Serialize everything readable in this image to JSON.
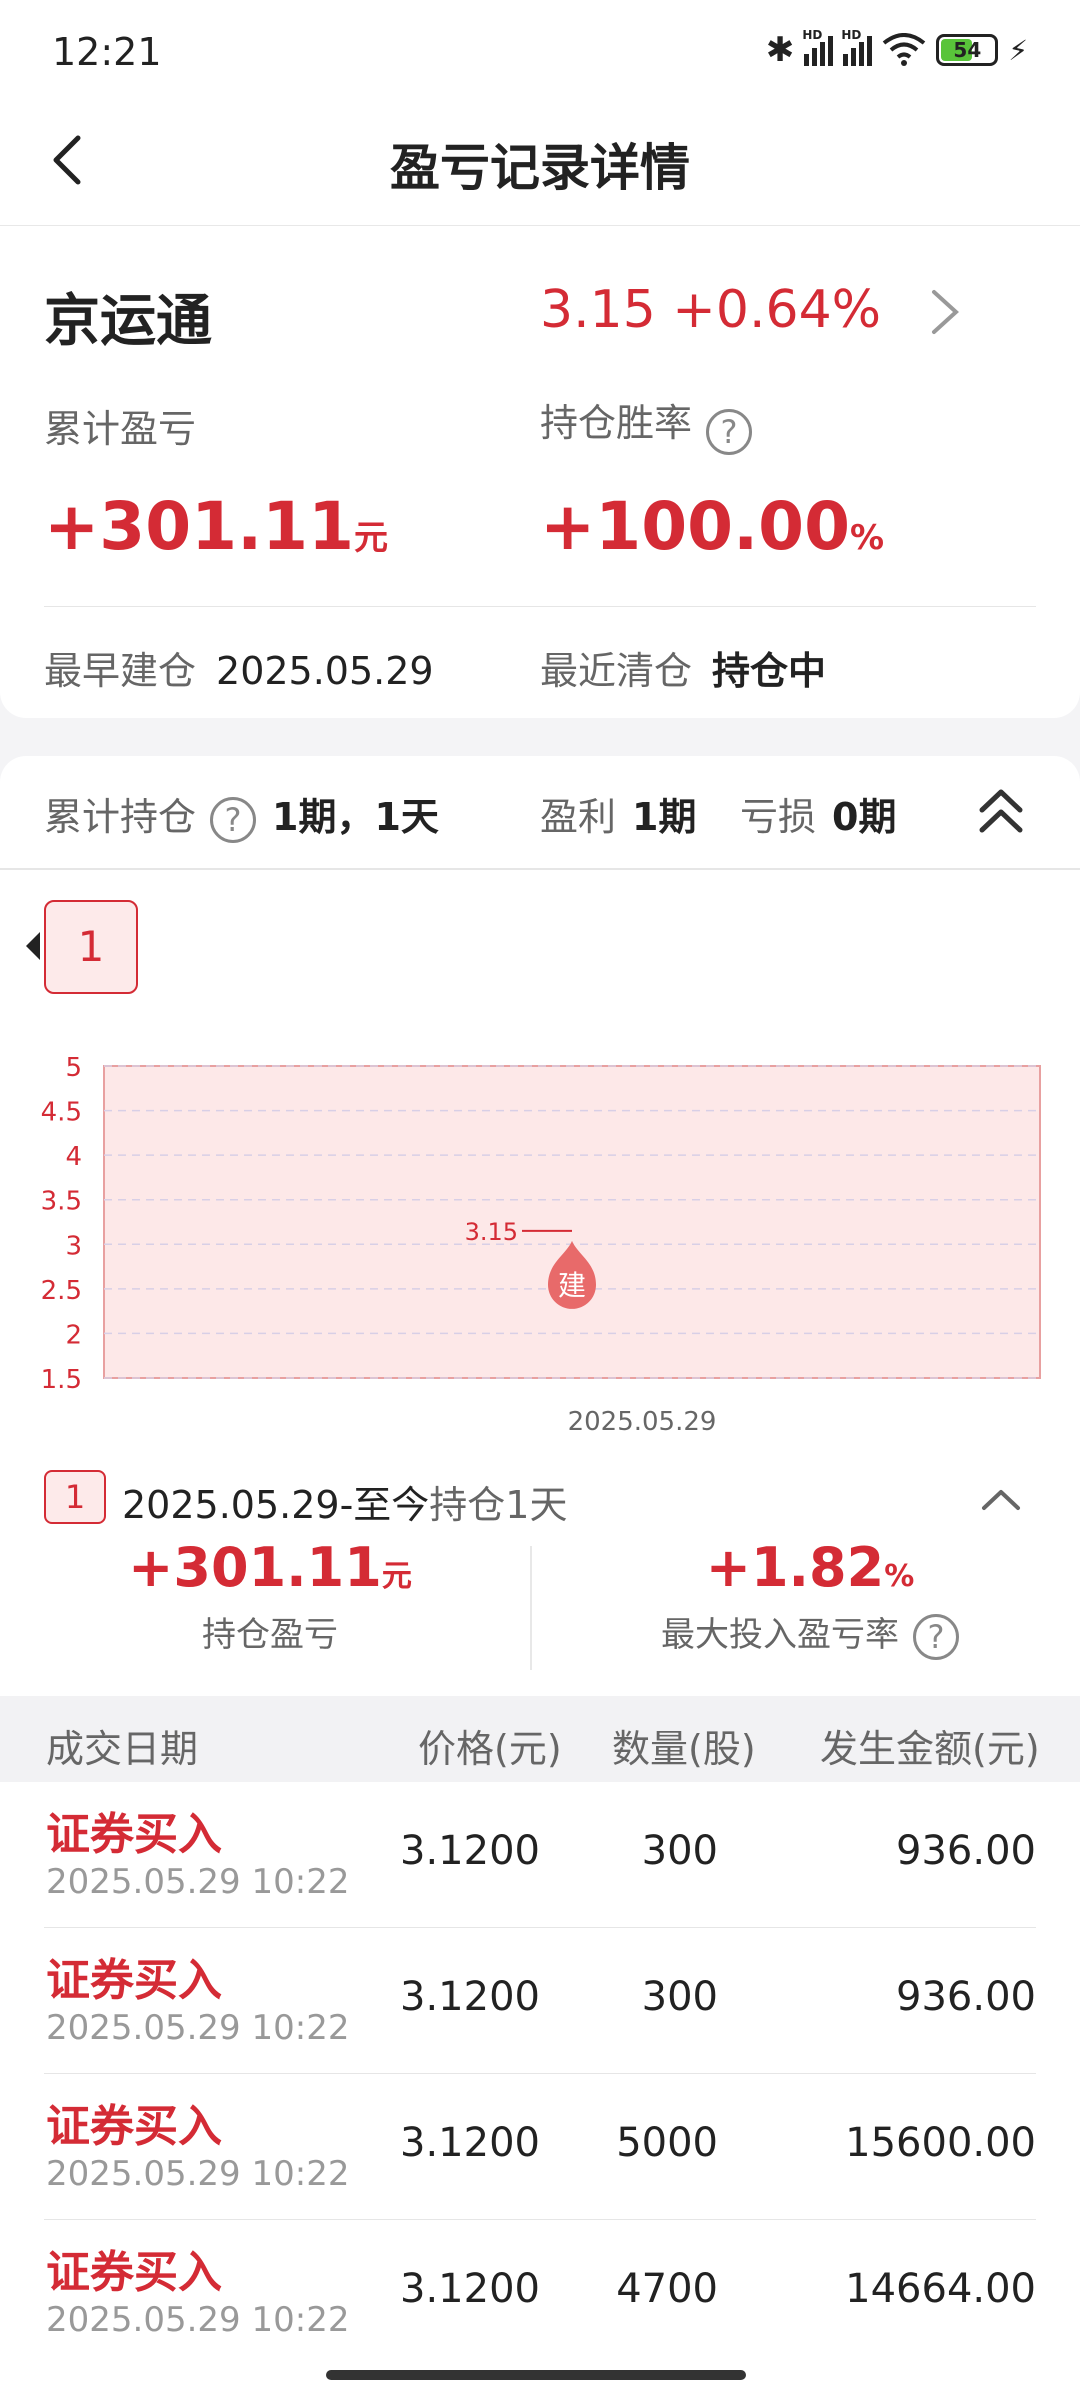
{
  "status_bar": {
    "time": "12:21",
    "battery": "54",
    "hd1": "HD",
    "hd2": "HD"
  },
  "header": {
    "title": "盈亏记录详情"
  },
  "stock": {
    "name": "京运通",
    "price_change": "3.15 +0.64%"
  },
  "summary": {
    "cum_pnl_label": "累计盈亏",
    "cum_pnl_value": "+301.11",
    "cum_pnl_unit": "元",
    "win_rate_label": "持仓胜率",
    "win_rate_value": "+100.00",
    "win_rate_unit": "%",
    "earliest_label": "最早建仓",
    "earliest_value": "2025.05.29",
    "recent_label": "最近清仓",
    "recent_value": "持仓中"
  },
  "holding_bar": {
    "cum_label": "累计持仓",
    "cum_value": "1期，1天",
    "profit_label": "盈利",
    "profit_value": "1期",
    "loss_label": "亏损",
    "loss_value": "0期"
  },
  "period_tag": "1",
  "chart_data": {
    "type": "line",
    "y_ticks": [
      "5",
      "4.5",
      "4",
      "3.5",
      "3",
      "2.5",
      "2",
      "1.5"
    ],
    "ylim": [
      1.5,
      5
    ],
    "x_label_date": "2025.05.29",
    "price_marker": {
      "value": 3.15,
      "label": "3.15"
    },
    "build_marker": "建",
    "grid": true
  },
  "period": {
    "tag": "1",
    "date_range": "2025.05.29-至今",
    "hold_text": "持仓1天",
    "pnl_value": "+301.11",
    "pnl_unit": "元",
    "pnl_label": "持仓盈亏",
    "rate_value": "+1.82",
    "rate_unit": "%",
    "rate_label": "最大投入盈亏率"
  },
  "table": {
    "headers": [
      "成交日期",
      "价格(元)",
      "数量(股)",
      "发生金额(元)"
    ],
    "rows": [
      {
        "type": "证券买入",
        "time": "2025.05.29 10:22",
        "price": "3.1200",
        "qty": "300",
        "amount": "936.00"
      },
      {
        "type": "证券买入",
        "time": "2025.05.29 10:22",
        "price": "3.1200",
        "qty": "300",
        "amount": "936.00"
      },
      {
        "type": "证券买入",
        "time": "2025.05.29 10:22",
        "price": "3.1200",
        "qty": "5000",
        "amount": "15600.00"
      },
      {
        "type": "证券买入",
        "time": "2025.05.29 10:22",
        "price": "3.1200",
        "qty": "4700",
        "amount": "14664.00"
      }
    ]
  },
  "colors": {
    "accent_red": "#d42b35",
    "chart_fill": "#fde8e8"
  }
}
